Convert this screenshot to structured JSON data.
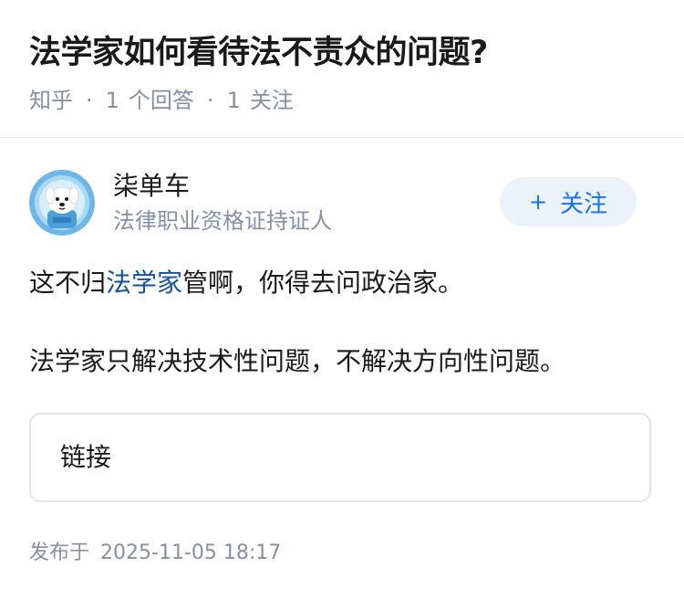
{
  "question": {
    "title": "法学家如何看待法不责众的问题?",
    "site": "知乎",
    "answer_count": "1",
    "answer_label": "个回答",
    "follow_count": "1",
    "follow_label": "关注"
  },
  "author": {
    "name": "柒单车",
    "bio": "法律职业资格证持证人",
    "avatar_icon": "dog-astronaut-avatar",
    "follow_button": "关注",
    "follow_icon": "plus-icon"
  },
  "answer": {
    "line1_prefix": "这不归",
    "line1_link": "法学家",
    "line1_suffix": "管啊，你得去问政治家。",
    "line2": "法学家只解决技术性问题，不解决方向性问题。"
  },
  "link_card": {
    "label": "链接"
  },
  "footer": {
    "published_label": "发布于",
    "published_time": "2025-11-05 18:17"
  },
  "colors": {
    "text": "#1a1a1a",
    "meta": "#8590a6",
    "link": "#175199",
    "button_bg": "#ebf2fa",
    "button_text": "#1772f6"
  }
}
